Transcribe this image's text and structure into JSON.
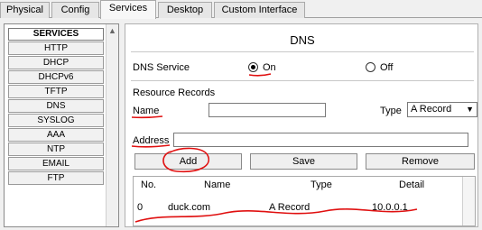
{
  "tabs": [
    {
      "label": "Physical"
    },
    {
      "label": "Config"
    },
    {
      "label": "Services"
    },
    {
      "label": "Desktop"
    },
    {
      "label": "Custom Interface"
    }
  ],
  "services": {
    "header": "SERVICES",
    "items": [
      "HTTP",
      "DHCP",
      "DHCPv6",
      "TFTP",
      "DNS",
      "SYSLOG",
      "AAA",
      "NTP",
      "EMAIL",
      "FTP"
    ]
  },
  "dns": {
    "title": "DNS",
    "service_label": "DNS Service",
    "on_label": "On",
    "off_label": "Off",
    "resource_records_label": "Resource Records",
    "name_label": "Name",
    "name_value": "",
    "type_label": "Type",
    "type_value": "A Record",
    "address_label": "Address",
    "address_value": "",
    "add_label": "Add",
    "save_label": "Save",
    "remove_label": "Remove"
  },
  "table": {
    "headers": [
      "No.",
      "Name",
      "Type",
      "Detail"
    ],
    "rows": [
      {
        "no": "0",
        "name": "duck.com",
        "type": "A Record",
        "detail": "10.0.0.1"
      }
    ]
  },
  "colors": {
    "annotation": "#e01010"
  }
}
